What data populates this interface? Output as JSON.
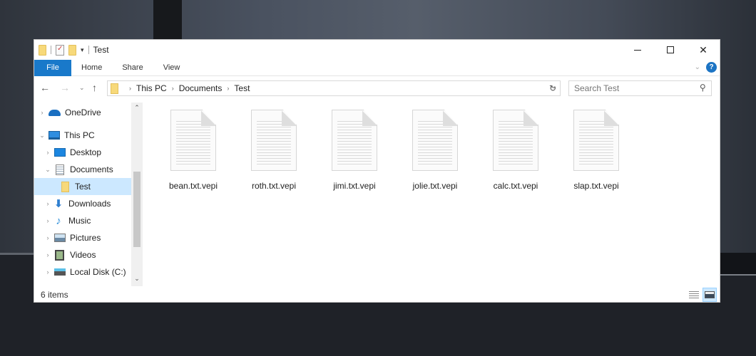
{
  "window": {
    "title": "Test",
    "controls": {
      "minimize": "minimize",
      "maximize": "maximize",
      "close": "✕"
    }
  },
  "ribbon": {
    "tabs": [
      {
        "label": "File",
        "active": true
      },
      {
        "label": "Home"
      },
      {
        "label": "Share"
      },
      {
        "label": "View"
      }
    ],
    "help_label": "?",
    "accent_color": "#1979ca"
  },
  "navbar": {
    "breadcrumb": [
      "This PC",
      "Documents",
      "Test"
    ],
    "search_placeholder": "Search Test"
  },
  "navpane": {
    "items": [
      {
        "label": "OneDrive",
        "icon": "onedrive-icon",
        "expander": "collapsed",
        "level": 0
      },
      {
        "label": "This PC",
        "icon": "computer-icon",
        "expander": "expanded",
        "level": 0
      },
      {
        "label": "Desktop",
        "icon": "desktop-icon",
        "expander": "collapsed",
        "level": 1
      },
      {
        "label": "Documents",
        "icon": "documents-icon",
        "expander": "expanded",
        "level": 1
      },
      {
        "label": "Test",
        "icon": "folder-icon",
        "expander": "none",
        "level": 2,
        "selected": true
      },
      {
        "label": "Downloads",
        "icon": "downloads-icon",
        "expander": "collapsed",
        "level": 1
      },
      {
        "label": "Music",
        "icon": "music-icon",
        "expander": "collapsed",
        "level": 1
      },
      {
        "label": "Pictures",
        "icon": "pictures-icon",
        "expander": "collapsed",
        "level": 1
      },
      {
        "label": "Videos",
        "icon": "videos-icon",
        "expander": "collapsed",
        "level": 1
      },
      {
        "label": "Local Disk (C:)",
        "icon": "local-disk-icon",
        "expander": "collapsed",
        "level": 1
      }
    ]
  },
  "files": [
    {
      "name": "bean.txt.vepi"
    },
    {
      "name": "roth.txt.vepi"
    },
    {
      "name": "jimi.txt.vepi"
    },
    {
      "name": "jolie.txt.vepi"
    },
    {
      "name": "calc.txt.vepi"
    },
    {
      "name": "slap.txt.vepi"
    }
  ],
  "status": {
    "item_count": "6 items",
    "view_modes": [
      "details",
      "large-icons"
    ],
    "active_view": "large-icons"
  }
}
